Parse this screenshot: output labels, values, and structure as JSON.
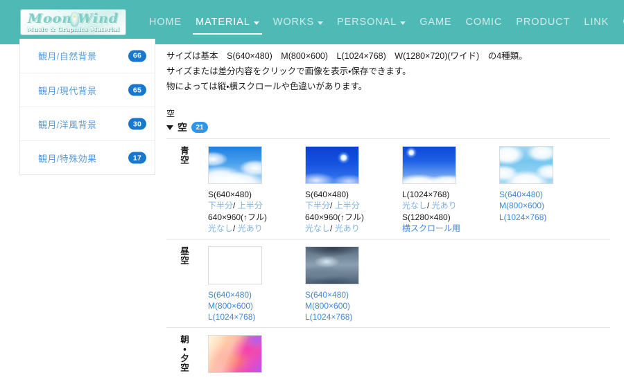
{
  "header": {
    "logo": {
      "word": "Moon Wind",
      "subtitle": "Music & Graphics Material",
      "star_icon": "star-icon"
    },
    "nav": [
      {
        "label": "HOME",
        "active": false,
        "has_caret": false
      },
      {
        "label": "MATERIAL",
        "active": true,
        "has_caret": true
      },
      {
        "label": "WORKS",
        "active": false,
        "has_caret": true
      },
      {
        "label": "PERSONAL",
        "active": false,
        "has_caret": true
      },
      {
        "label": "GAME",
        "active": false,
        "has_caret": false
      },
      {
        "label": "COMIC",
        "active": false,
        "has_caret": false
      },
      {
        "label": "PRODUCT",
        "active": false,
        "has_caret": false
      },
      {
        "label": "LINK",
        "active": false,
        "has_caret": false
      },
      {
        "label": "CONTACT",
        "active": false,
        "has_caret": false
      }
    ],
    "bg_color": "#4fb9b6"
  },
  "sidebar": {
    "items": [
      {
        "label": "観月/自然背景",
        "count": "66"
      },
      {
        "label": "観月/現代背景",
        "count": "65"
      },
      {
        "label": "観月/洋風背景",
        "count": "30"
      },
      {
        "label": "観月/特殊効果",
        "count": "17"
      }
    ],
    "badge_color": "#1878d0",
    "link_color": "#5b9bd5"
  },
  "main": {
    "intro": [
      "サイズは基本　S(640×480)　M(800×600)　L(1024×768)　W(1280×720)(ワイド)　の4種類。",
      "サイズまたは差分内容をクリックで画像を表示・保存できます。",
      "物によっては縦・横スクロールや色違いがあります。"
    ],
    "group_title": "空",
    "group_toggle": {
      "label": "空",
      "count": "21",
      "expanded": true,
      "badge_color": "#2f96f0"
    },
    "rows": [
      {
        "label": "青空",
        "items": [
          {
            "thumb": "blue-sky-clouds-thumb",
            "lines": [
              {
                "parts": [
                  {
                    "text": "S(640×480)",
                    "link": false
                  }
                ]
              },
              {
                "parts": [
                  {
                    "text": "下半分",
                    "link": true
                  },
                  {
                    "text": "/ ",
                    "link": false
                  },
                  {
                    "text": "上半分",
                    "link": true
                  }
                ]
              },
              {
                "parts": [
                  {
                    "text": "640×960(↑フル)",
                    "link": false
                  }
                ]
              },
              {
                "parts": [
                  {
                    "text": "光なし",
                    "link": true
                  },
                  {
                    "text": "/ ",
                    "link": false
                  },
                  {
                    "text": "光あり",
                    "link": true
                  }
                ]
              }
            ]
          },
          {
            "thumb": "deep-blue-sky-sun-thumb",
            "lines": [
              {
                "parts": [
                  {
                    "text": "S(640×480)",
                    "link": false
                  }
                ]
              },
              {
                "parts": [
                  {
                    "text": "下半分",
                    "link": true
                  },
                  {
                    "text": "/ ",
                    "link": false
                  },
                  {
                    "text": "上半分",
                    "link": true
                  }
                ]
              },
              {
                "parts": [
                  {
                    "text": "640×960(↑フル)",
                    "link": false
                  }
                ]
              },
              {
                "parts": [
                  {
                    "text": "光なし",
                    "link": true
                  },
                  {
                    "text": "/ ",
                    "link": false
                  },
                  {
                    "text": "光あり",
                    "link": true
                  }
                ]
              }
            ]
          },
          {
            "thumb": "blue-sky-sun-clouds-thumb",
            "lines": [
              {
                "parts": [
                  {
                    "text": "L(1024×768)",
                    "link": false
                  }
                ]
              },
              {
                "parts": [
                  {
                    "text": "光なし",
                    "link": true
                  },
                  {
                    "text": "/ ",
                    "link": false
                  },
                  {
                    "text": "光あり",
                    "link": true
                  }
                ]
              },
              {
                "parts": [
                  {
                    "text": "S(1280×480)",
                    "link": false
                  }
                ]
              },
              {
                "parts": [
                  {
                    "text": "横スクロール用",
                    "link": true
                  }
                ]
              }
            ]
          },
          {
            "thumb": "pale-blue-sky-thumb",
            "lines": [
              {
                "parts": [
                  {
                    "text": "S(640×480)",
                    "link": true
                  }
                ]
              },
              {
                "parts": [
                  {
                    "text": "M(800×600)",
                    "link": true
                  }
                ]
              },
              {
                "parts": [
                  {
                    "text": "L(1024×768)",
                    "link": true
                  }
                ]
              }
            ]
          }
        ]
      },
      {
        "label": "昼空",
        "items": [
          {
            "thumb": "cloudy-sky-rays-thumb",
            "lines": [
              {
                "parts": [
                  {
                    "text": "S(640×480)",
                    "link": true
                  }
                ]
              },
              {
                "parts": [
                  {
                    "text": "M(800×600)",
                    "link": true
                  }
                ]
              },
              {
                "parts": [
                  {
                    "text": "L(1024×768)",
                    "link": true
                  }
                ]
              }
            ]
          },
          {
            "thumb": "dark-cloudy-sky-thumb",
            "lines": [
              {
                "parts": [
                  {
                    "text": "S(640×480)",
                    "link": true
                  }
                ]
              },
              {
                "parts": [
                  {
                    "text": "M(800×600)",
                    "link": true
                  }
                ]
              },
              {
                "parts": [
                  {
                    "text": "L(1024×768)",
                    "link": true
                  }
                ]
              }
            ]
          }
        ]
      },
      {
        "label": "朝・夕空",
        "items": [
          {
            "thumb": "sunset-sky-thumb",
            "lines": []
          }
        ]
      }
    ]
  }
}
